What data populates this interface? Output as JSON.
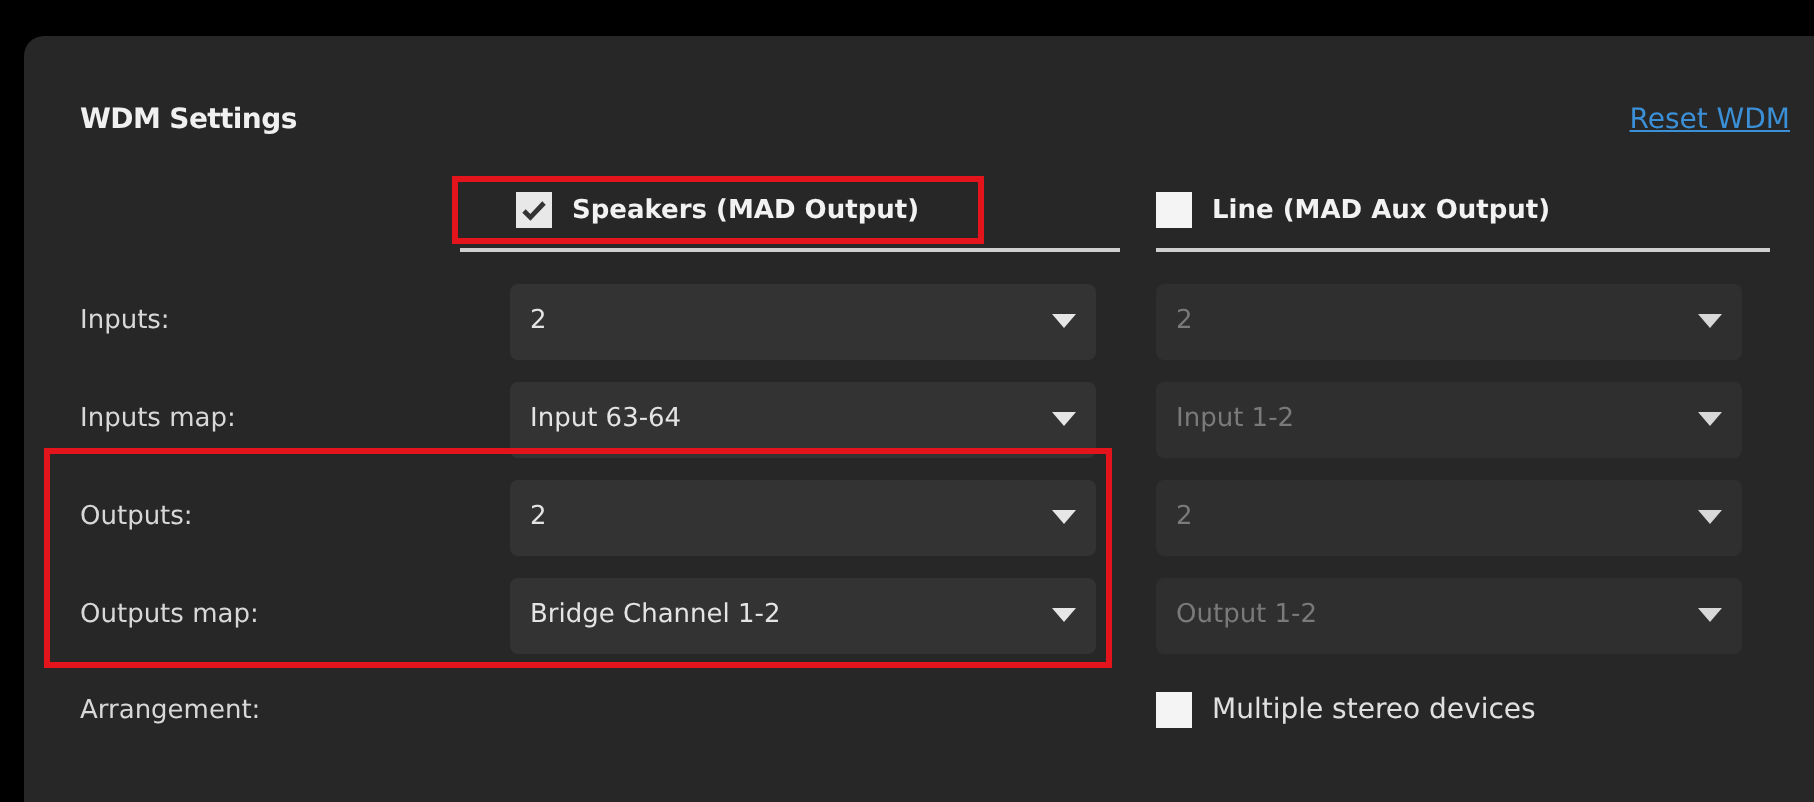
{
  "panel": {
    "title": "WDM Settings",
    "reset_link": "Reset WDM"
  },
  "outputs": [
    {
      "label": "Speakers (MAD Output)",
      "checked": true,
      "highlighted": true,
      "disabled": false
    },
    {
      "label": "Line (MAD Aux Output)",
      "checked": false,
      "highlighted": false,
      "disabled": true
    }
  ],
  "rows": [
    {
      "label": "Inputs:",
      "highlighted": false,
      "values": [
        "2",
        "2"
      ]
    },
    {
      "label": "Inputs map:",
      "highlighted": false,
      "values": [
        "Input 63-64",
        "Input 1-2"
      ]
    },
    {
      "label": "Outputs:",
      "highlighted": true,
      "values": [
        "2",
        "2"
      ]
    },
    {
      "label": "Outputs map:",
      "highlighted": true,
      "values": [
        "Bridge Channel 1-2",
        "Output 1-2"
      ]
    }
  ],
  "arrangement": {
    "label": "Arrangement:",
    "checkbox": {
      "label": "Multiple stereo devices",
      "checked": false
    }
  }
}
